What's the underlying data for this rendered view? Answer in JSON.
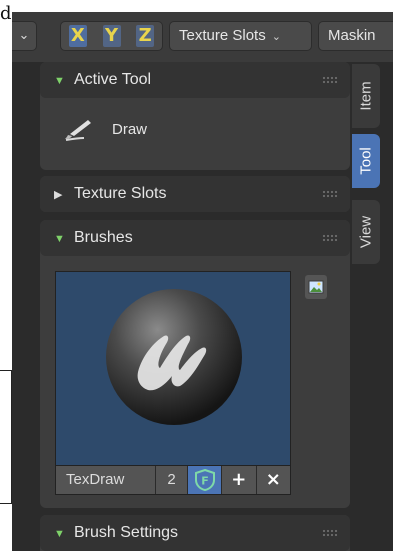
{
  "background": {
    "letter": "d"
  },
  "header": {
    "mode_stub_chevron": "⌄",
    "axes": [
      "X",
      "Y",
      "Z"
    ],
    "texture_slots_label": "Texture Slots",
    "masking_label": "Maskin"
  },
  "sidebar_tabs": [
    "Item",
    "Tool",
    "View"
  ],
  "active_tab": "Tool",
  "panels": {
    "active_tool": {
      "title": "Active Tool",
      "tool_name": "Draw"
    },
    "texture_slots": {
      "title": "Texture Slots"
    },
    "brushes": {
      "title": "Brushes",
      "brush_name": "TexDraw",
      "user_count": "2",
      "fake_user": "F",
      "add": "+",
      "remove": "×"
    },
    "brush_settings": {
      "title": "Brush Settings"
    }
  },
  "colors": {
    "accent_blue": "#4b74b5",
    "preview_bg": "#2e4a6b",
    "axis_yellow": "#e8d44d",
    "open_triangle": "#7fd26a"
  },
  "icons": {
    "tool": "draw-brush-icon",
    "preview": "brush-sphere-icon",
    "image_browse": "image-browse-icon",
    "fake_user": "fake-user-shield-icon"
  }
}
